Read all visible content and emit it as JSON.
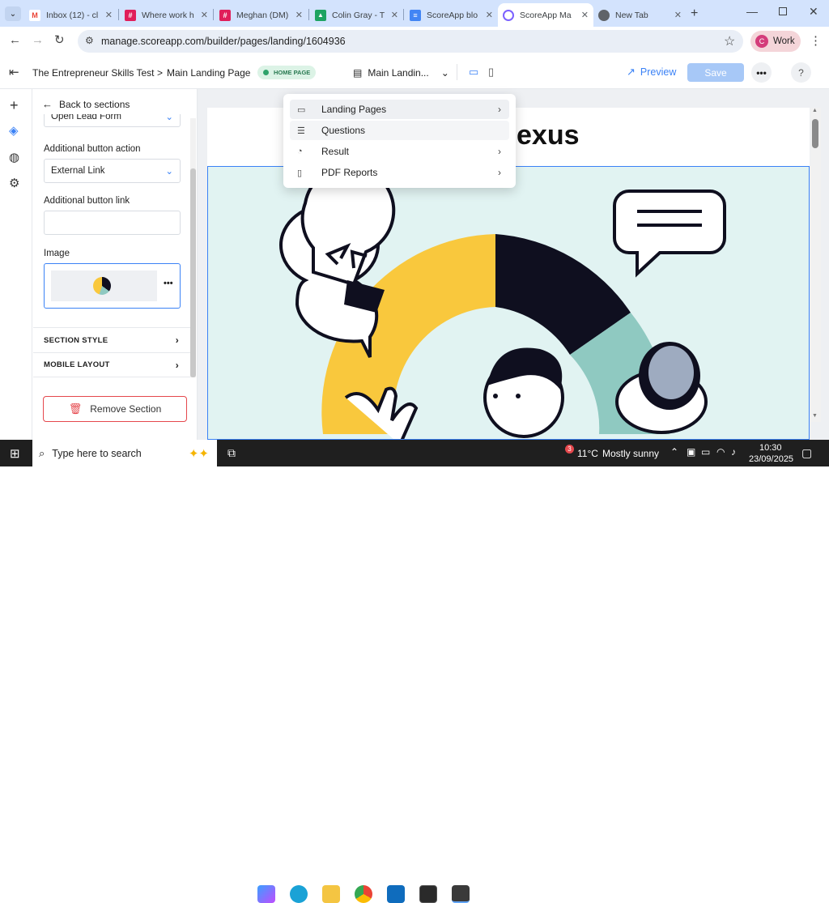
{
  "browser": {
    "tabs": [
      {
        "title": "Inbox (12) - cl",
        "icon": "gmail-icon",
        "color": "#ea4335",
        "glyph": "M"
      },
      {
        "title": "Where work h",
        "icon": "slack-icon",
        "color": "#e01e5a",
        "glyph": "#"
      },
      {
        "title": "Meghan (DM)",
        "icon": "slack-icon",
        "color": "#e01e5a",
        "glyph": "#"
      },
      {
        "title": "Colin Gray - T",
        "icon": "google-drive-icon",
        "color": "#1ea362",
        "glyph": "▲"
      },
      {
        "title": "ScoreApp blo",
        "icon": "google-docs-icon",
        "color": "#4285f4",
        "glyph": "≡"
      },
      {
        "title": "ScoreApp Ma",
        "icon": "scoreapp-icon",
        "color": "#7b61ff",
        "glyph": "○"
      },
      {
        "title": "New Tab",
        "icon": "chrome-icon",
        "color": "#5f6368",
        "glyph": "◎"
      }
    ],
    "url": "manage.scoreapp.com/builder/pages/landing/1604936",
    "profile_label": "Work",
    "profile_initial": "C"
  },
  "header": {
    "breadcrumb_root": "The Entrepreneur Skills Test",
    "breadcrumb_sep": ">",
    "breadcrumb_page": "Main Landing Page",
    "badge": "HOME PAGE",
    "page_selector": "Main Landin...",
    "preview_label": "Preview",
    "save_label": "Save",
    "help_label": "?"
  },
  "panel": {
    "back_label": "Back to sections",
    "first_select": "Open Lead Form",
    "additional_action_label": "Additional button action",
    "additional_action_value": "External Link",
    "additional_link_label": "Additional button link",
    "additional_link_value": "",
    "image_label": "Image",
    "section_style_label": "SECTION STYLE",
    "mobile_layout_label": "MOBILE LAYOUT",
    "remove_label": "Remove Section"
  },
  "menu": {
    "items": [
      {
        "label": "Landing Pages",
        "icon": "layout-icon",
        "has_submenu": true
      },
      {
        "label": "Questions",
        "icon": "list-icon",
        "has_submenu": false
      },
      {
        "label": "Result",
        "icon": "result-chart-icon",
        "has_submenu": true
      },
      {
        "label": "PDF Reports",
        "icon": "pdf-icon",
        "has_submenu": true
      }
    ]
  },
  "canvas": {
    "heading_fragment": "exus"
  },
  "taskbar": {
    "search_placeholder": "Type here to search",
    "temperature": "11°C",
    "weather": "Mostly sunny",
    "weather_badge": "3",
    "time": "10:30",
    "date": "23/09/2025"
  },
  "colors": {
    "accent": "#3b82f6",
    "save_disabled": "#a7c8f7",
    "badge_green": "#2fa36b",
    "remove_red": "#e5484d",
    "chart_yellow": "#f9c83d",
    "chart_navy": "#0f0f1f",
    "chart_teal": "#8fc9c1",
    "hero_bg": "#e1f3f2"
  }
}
